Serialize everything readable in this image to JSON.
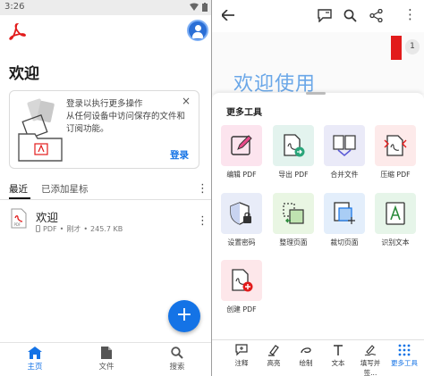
{
  "status": {
    "time": "3:26"
  },
  "home": {
    "welcome": "欢迎",
    "promo": {
      "line1": "登录以执行更多操作",
      "line2": "从任何设备中访问保存的文件和",
      "line3": "订阅功能。",
      "close": "×",
      "signin": "登录"
    },
    "tabs": [
      {
        "label": "最近"
      },
      {
        "label": "已添加星标"
      }
    ],
    "files": [
      {
        "name": "欢迎",
        "type": "PDF",
        "time": "刚才",
        "size": "245.7 KB"
      }
    ],
    "fab": "+",
    "nav": [
      {
        "label": "主页"
      },
      {
        "label": "文件"
      },
      {
        "label": "搜索"
      }
    ]
  },
  "viewer": {
    "page_number": "1",
    "doc_title": "欢迎使用",
    "sheet_title": "更多工具",
    "tools": [
      {
        "label": "编辑 PDF",
        "color": "#fce4ee"
      },
      {
        "label": "导出 PDF",
        "color": "#e3f3ee"
      },
      {
        "label": "合并文件",
        "color": "#eaeaf8"
      },
      {
        "label": "压缩 PDF",
        "color": "#fdeaea"
      },
      {
        "label": "设置密码",
        "color": "#e8ecf8"
      },
      {
        "label": "整理页面",
        "color": "#e9f6e3"
      },
      {
        "label": "裁切页面",
        "color": "#e3eefb"
      },
      {
        "label": "识别文本",
        "color": "#e6f5e9"
      },
      {
        "label": "创建 PDF",
        "color": "#fde7ea"
      }
    ],
    "toolbar": [
      {
        "label": "注释"
      },
      {
        "label": "高亮"
      },
      {
        "label": "绘制"
      },
      {
        "label": "文本"
      },
      {
        "label": "填写并签..."
      },
      {
        "label": "更多工具"
      }
    ]
  },
  "colors": {
    "accent": "#1473e6",
    "acrobat_red": "#e21b1b"
  }
}
